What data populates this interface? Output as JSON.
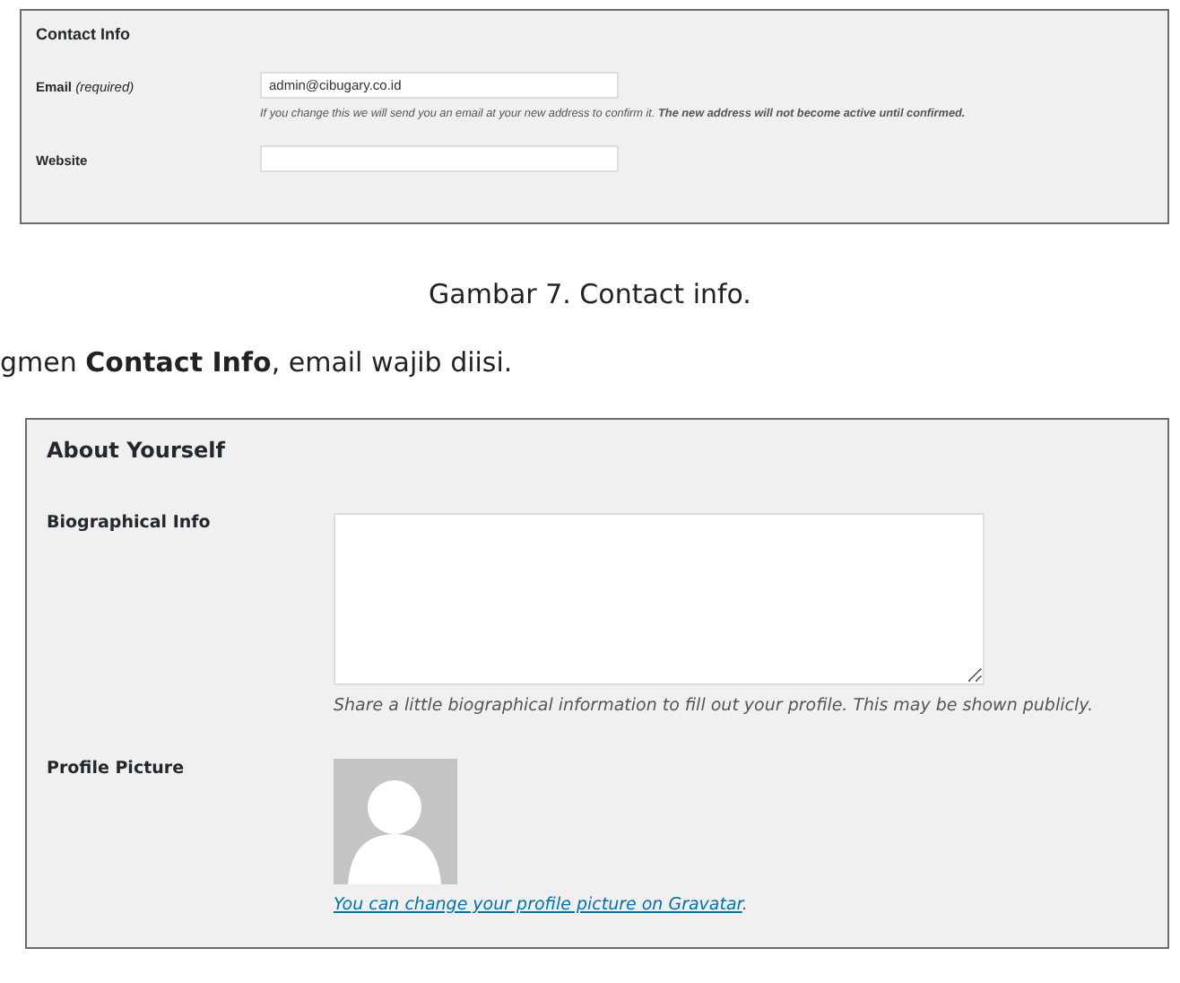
{
  "contact_panel": {
    "title": "Contact Info",
    "fields": [
      {
        "label": "Email",
        "label_note": "(required)",
        "value": "admin@cibugary.co.id",
        "hint": "If you change this we will send you an email at your new address to confirm it. **The new address will not become active until confirmed.**"
      },
      {
        "label": "Website"
      }
    ]
  },
  "caption": "Gambar 7. Contact info.",
  "paragraph": "gmen **Contact Info**, email wajib diisi.",
  "about_panel": {
    "title": "About Yourself",
    "bio": {
      "label": "Biographical Info",
      "hint": "Share a little biographical information to fill out your profile. This may be shown publicly."
    },
    "picture": {
      "label": "Profile Picture",
      "link": "You can change your profile picture on Gravatar",
      "link_suffix": "."
    }
  }
}
